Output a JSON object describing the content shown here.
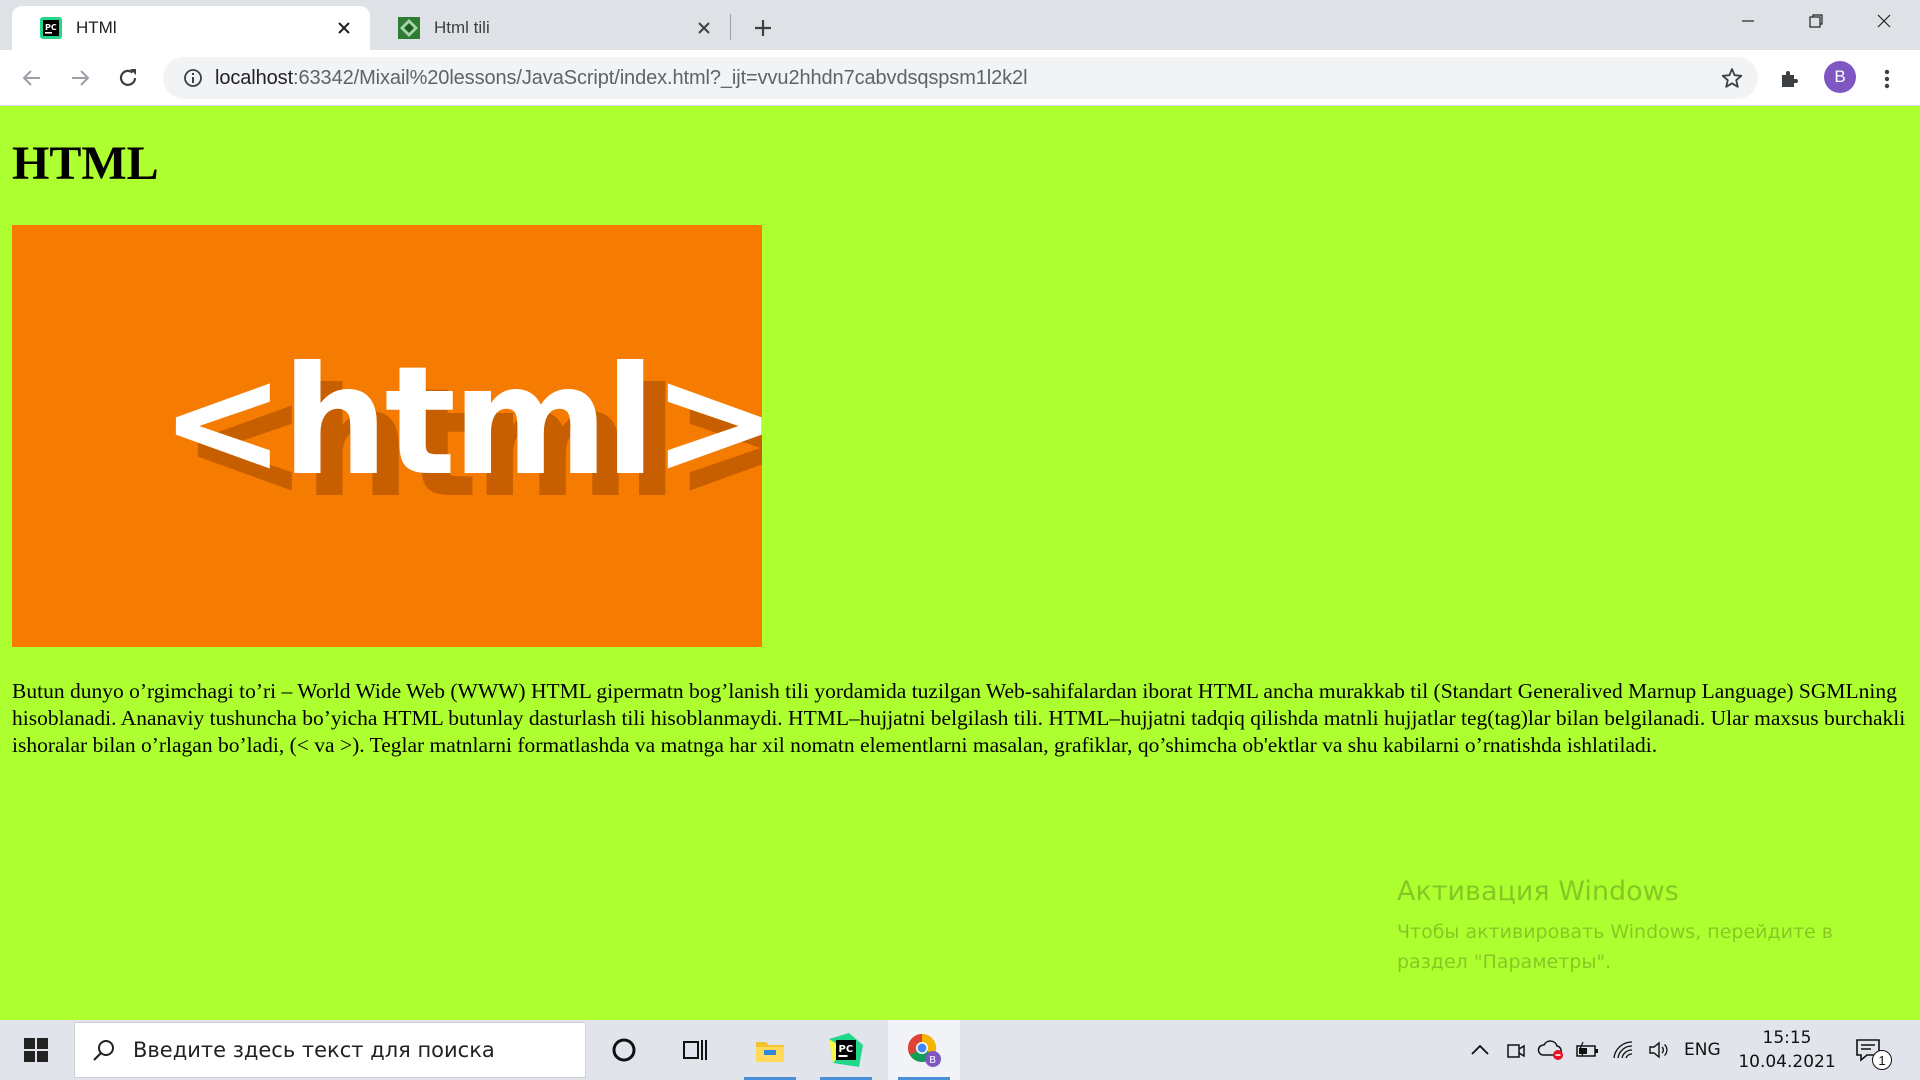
{
  "browser": {
    "tabs": [
      {
        "title": "HTMl",
        "active": true,
        "favicon": "pycharm-icon"
      },
      {
        "title": "Html tili",
        "active": false,
        "favicon": "html-tili-favicon"
      }
    ],
    "address_host": "localhost",
    "address_rest": ":63342/Mixail%20lessons/JavaScript/index.html?_ijt=vvu2hhdn7cabvdsqspsm1l2k2l",
    "profile_initial": "B",
    "accent_color": "#7e57c2"
  },
  "page": {
    "heading": "HTML",
    "logo_text": "<html>",
    "paragraph": "Butun dunyo o’rgimchagi to’ri – World Wide Web (WWW) HTML gipermatn bog’lanish tili yordamida tuzilgan Web-sahifalardan iborat HTML ancha murakkab til (Standart Generalived Marnup Language) SGMLning hisoblanadi. Ananaviy tushuncha bo’yicha HTML butunlay dasturlash tili hisoblanmaydi. HTML–hujjatni belgilash tili. HTML–hujjatni tadqiq qilishda matnli hujjatlar teg(tag)lar bilan belgilanadi. Ular maxsus burchakli ishoralar bilan o’rlagan bo’ladi, (< va >). Teglar matnlarni formatlashda va matnga har xil nomatn elementlarni masalan, grafiklar, qo’shimcha ob'ektlar va shu kabilarni o’rnatishda ishlatiladi.",
    "background_color": "#adff2f",
    "logo_bg_color": "#f57c00"
  },
  "watermark": {
    "title": "Активация Windows",
    "line": "Чтобы активировать Windows, перейдите в раздел \"Параметры\"."
  },
  "taskbar": {
    "search_placeholder": "Введите здесь текст для поиска",
    "language": "ENG",
    "time": "15:15",
    "date": "10.04.2021",
    "notification_count": "1"
  }
}
